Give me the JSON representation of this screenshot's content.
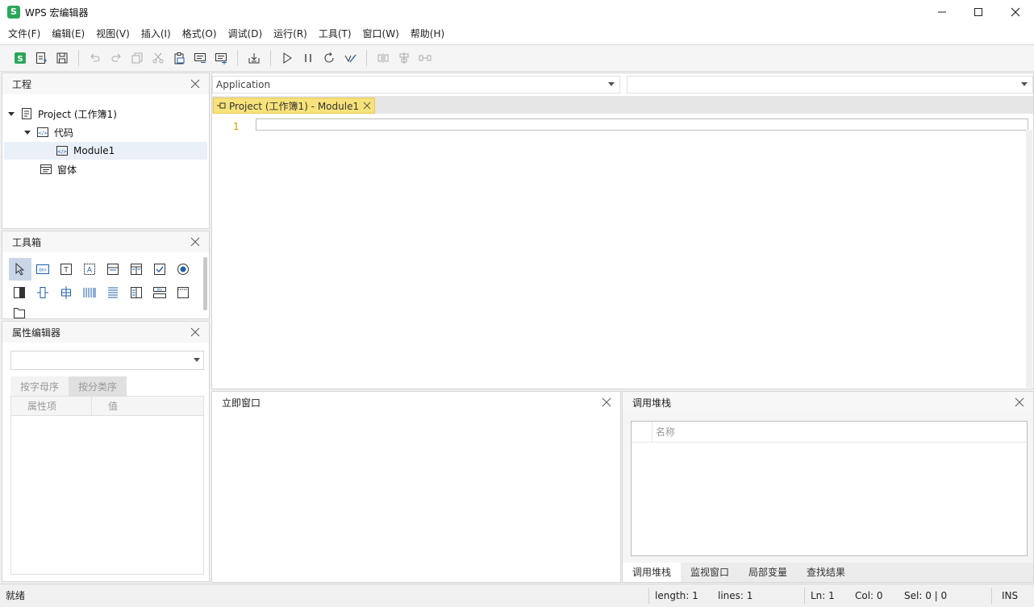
{
  "window": {
    "app_icon_letter": "S",
    "title": "WPS 宏编辑器",
    "minimize_glyph": "—",
    "maximize_glyph": "☐",
    "close_glyph": "✕"
  },
  "menu": [
    {
      "label": "文件(F)"
    },
    {
      "label": "编辑(E)"
    },
    {
      "label": "视图(V)"
    },
    {
      "label": "插入(I)"
    },
    {
      "label": "格式(O)"
    },
    {
      "label": "调试(D)"
    },
    {
      "label": "运行(R)"
    },
    {
      "label": "工具(T)"
    },
    {
      "label": "窗口(W)"
    },
    {
      "label": "帮助(H)"
    }
  ],
  "toolbar_icons": [
    "wps-logo-icon",
    "new-module-icon",
    "save-icon",
    "undo-icon",
    "redo-icon",
    "copy-icon",
    "cut-icon",
    "paste-icon",
    "comment-icon",
    "uncomment-icon",
    "import-icon",
    "run-icon",
    "pause-icon",
    "reset-icon",
    "design-mode-icon",
    "align-icon",
    "center-icon",
    "distribute-icon"
  ],
  "project_panel": {
    "title": "工程",
    "tree": {
      "root": "Project (工作簿1)",
      "code_folder": "代码",
      "module": "Module1",
      "forms_folder": "窗体"
    }
  },
  "toolbox_panel": {
    "title": "工具箱"
  },
  "property_panel": {
    "title": "属性编辑器",
    "tab_alpha": "按字母序",
    "tab_category": "按分类序",
    "col_property": "属性项",
    "col_value": "值"
  },
  "editor": {
    "object_combo": "Application",
    "procedure_combo": "",
    "tab_label": "Project (工作簿1) - Module1",
    "line_number": "1"
  },
  "immediate_panel": {
    "title": "立即窗口"
  },
  "callstack_panel": {
    "title": "调用堆栈",
    "col_name": "名称",
    "tabs": [
      "调用堆栈",
      "监视窗口",
      "局部变量",
      "查找结果"
    ]
  },
  "statusbar": {
    "state": "就绪",
    "length": "length: 1",
    "lines": "lines: 1",
    "ln": "Ln: 1",
    "col": "Col: 0",
    "sel": "Sel: 0 | 0",
    "mode": "INS"
  },
  "colors": {
    "accent_green": "#2ca65a",
    "tab_yellow": "#f8e27a",
    "line_number": "#d4a000",
    "icon_blue": "#1f5fa8"
  }
}
